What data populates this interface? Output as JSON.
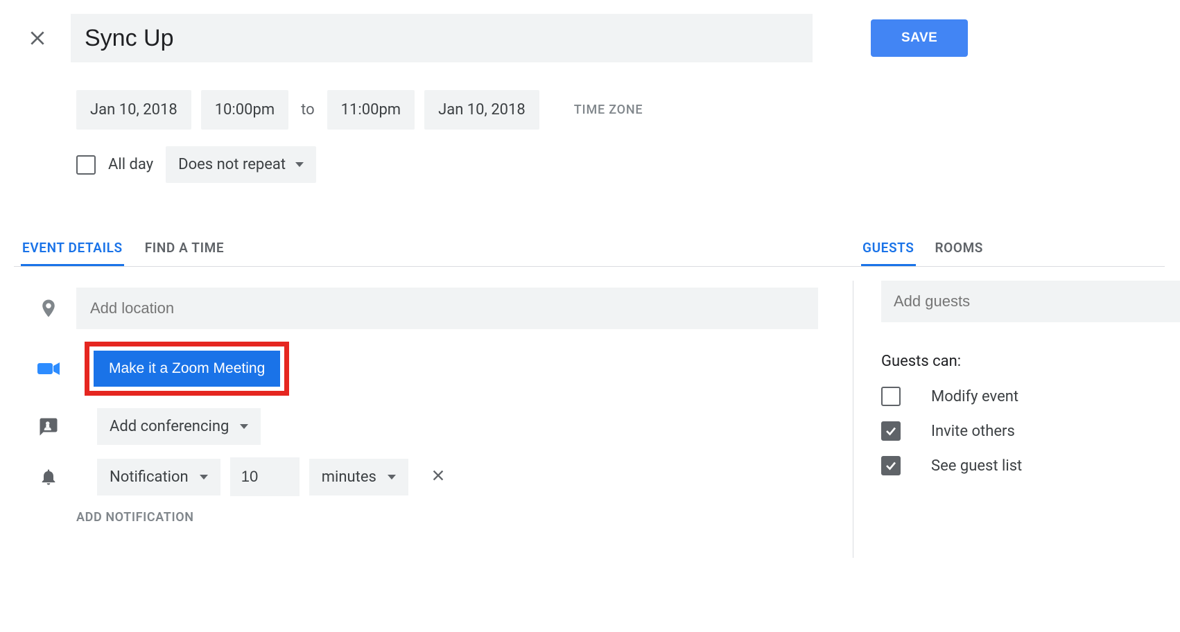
{
  "header": {
    "title_value": "Sync Up",
    "save_label": "SAVE"
  },
  "datetime": {
    "start_date": "Jan 10, 2018",
    "start_time": "10:00pm",
    "to_label": "to",
    "end_time": "11:00pm",
    "end_date": "Jan 10, 2018",
    "timezone_label": "TIME ZONE"
  },
  "allday": {
    "label": "All day",
    "checked": false
  },
  "repeat": {
    "label": "Does not repeat"
  },
  "tabs": {
    "left": [
      {
        "label": "EVENT DETAILS",
        "active": true
      },
      {
        "label": "FIND A TIME",
        "active": false
      }
    ],
    "right": [
      {
        "label": "GUESTS",
        "active": true
      },
      {
        "label": "ROOMS",
        "active": false
      }
    ]
  },
  "location": {
    "placeholder": "Add location"
  },
  "zoom": {
    "button_label": "Make it a Zoom Meeting"
  },
  "conferencing": {
    "label": "Add conferencing"
  },
  "notification": {
    "type": "Notification",
    "value": "10",
    "unit": "minutes",
    "add_label": "ADD NOTIFICATION"
  },
  "guests": {
    "placeholder": "Add guests",
    "can_label": "Guests can:",
    "permissions": [
      {
        "label": "Modify event",
        "checked": false
      },
      {
        "label": "Invite others",
        "checked": true
      },
      {
        "label": "See guest list",
        "checked": true
      }
    ]
  }
}
